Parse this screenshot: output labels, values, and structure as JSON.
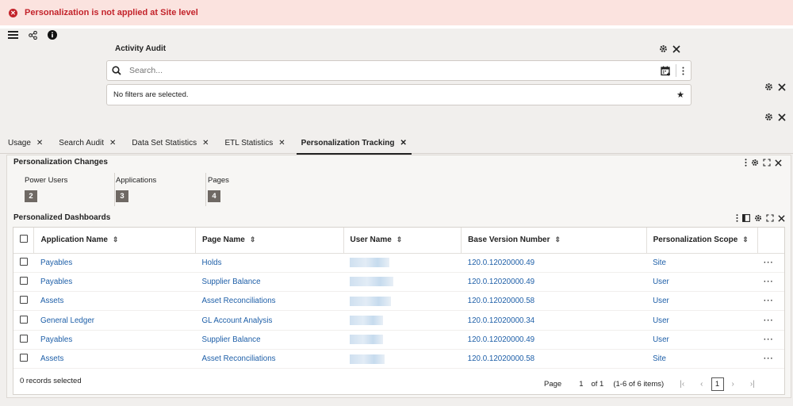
{
  "banner": {
    "message": "Personalization is not applied at Site level",
    "icon": "error-icon",
    "color": "#c3232b"
  },
  "toolbar": {
    "menu_icon": "hamburger-menu-icon",
    "share_icon": "share-icon",
    "info_icon": "info-icon"
  },
  "activity_audit": {
    "title": "Activity Audit",
    "search_placeholder": "Search...",
    "filter_text": "No filters are selected."
  },
  "tabs": [
    {
      "label": "Usage",
      "active": false
    },
    {
      "label": "Search Audit",
      "active": false
    },
    {
      "label": "Data Set Statistics",
      "active": false
    },
    {
      "label": "ETL Statistics",
      "active": false
    },
    {
      "label": "Personalization Tracking",
      "active": true
    }
  ],
  "personalization_changes": {
    "title": "Personalization Changes",
    "metrics": [
      {
        "label": "Power Users",
        "value": "2"
      },
      {
        "label": "Applications",
        "value": "3"
      },
      {
        "label": "Pages",
        "value": "4"
      }
    ]
  },
  "dashboards": {
    "title": "Personalized Dashboards",
    "columns": [
      "Application Name",
      "Page Name",
      "User Name",
      "Base Version Number",
      "Personalization Scope"
    ],
    "rows": [
      {
        "app": "Payables",
        "page": "Holds",
        "version": "120.0.12020000.49",
        "scope": "Site"
      },
      {
        "app": "Payables",
        "page": "Supplier Balance",
        "version": "120.0.12020000.49",
        "scope": "User"
      },
      {
        "app": "Assets",
        "page": "Asset Reconciliations",
        "version": "120.0.12020000.58",
        "scope": "User"
      },
      {
        "app": "General Ledger",
        "page": "GL Account Analysis",
        "version": "120.0.12020000.34",
        "scope": "User"
      },
      {
        "app": "Payables",
        "page": "Supplier Balance",
        "version": "120.0.12020000.49",
        "scope": "User"
      },
      {
        "app": "Assets",
        "page": "Asset Reconciliations",
        "version": "120.0.12020000.58",
        "scope": "Site"
      }
    ],
    "records_selected": "0 records selected",
    "pager": {
      "page_label": "Page",
      "page_value": "1",
      "of_label": "of 1",
      "items": "(1-6 of 6 items)",
      "current": "1"
    }
  },
  "colors": {
    "link": "#1e5fa8",
    "badge": "#6f6964",
    "banner_bg": "#fbe3df"
  }
}
